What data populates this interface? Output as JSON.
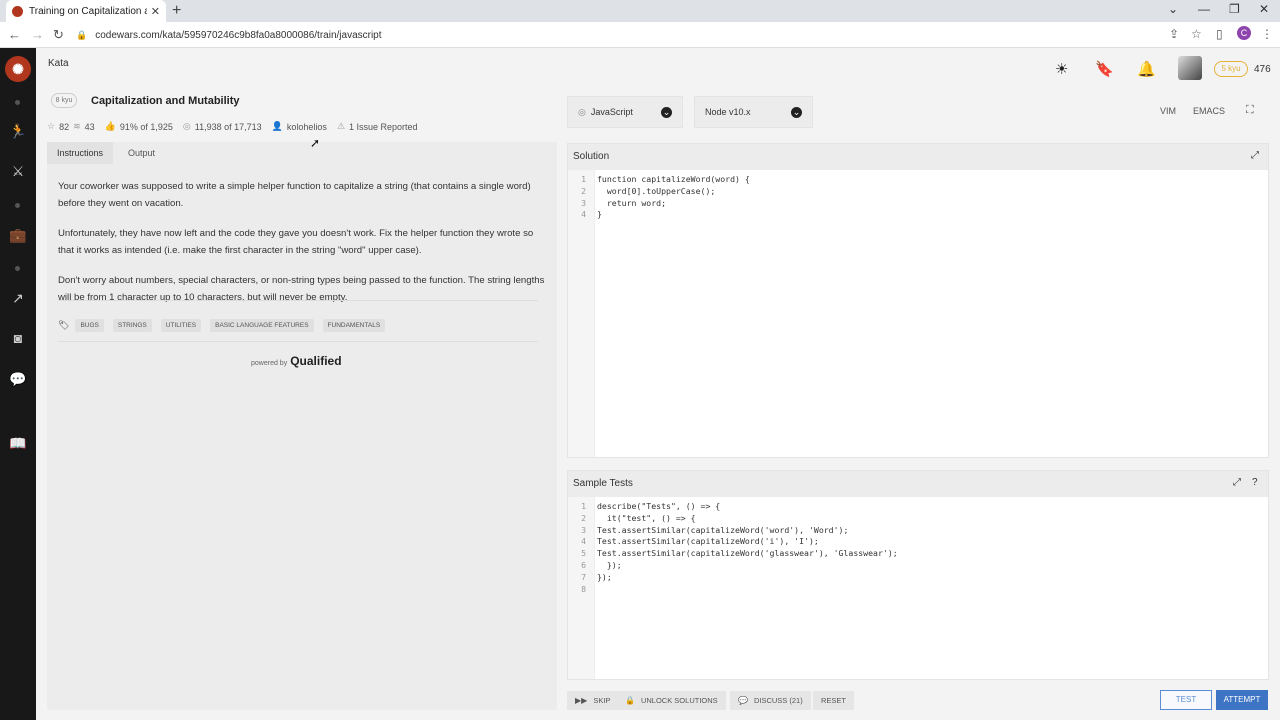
{
  "browser": {
    "tab_title": "Training on Capitalization and M",
    "url": "codewars.com/kata/595970246c9b8fa0a8000086/train/javascript",
    "profile_initial": "C"
  },
  "header": {
    "kata_link": "Kata",
    "rank_badge": "5 kyu",
    "honor": "476"
  },
  "kata": {
    "kyu": "8 kyu",
    "title": "Capitalization and Mutability",
    "stars": "82",
    "collections": "43",
    "satisfaction": "91% of 1,925",
    "completions": "11,938 of 17,713",
    "author": "kolohelios",
    "issues": "1 Issue Reported"
  },
  "left_tabs": [
    "Instructions",
    "Output"
  ],
  "description": [
    "Your coworker was supposed to write a simple helper function to capitalize a string (that contains a single word) before they went on vacation.",
    "Unfortunately, they have now left and the code they gave you doesn't work. Fix the helper function they wrote so that it works as intended (i.e. make the first character in the string \"word\" upper case).",
    "Don't worry about numbers, special characters, or non-string types being passed to the function. The string lengths will be from 1 character up to 10 characters, but will never be empty."
  ],
  "tags": [
    "BUGS",
    "STRINGS",
    "UTILITIES",
    "BASIC LANGUAGE FEATURES",
    "FUNDAMENTALS"
  ],
  "powered": {
    "label": "powered by",
    "brand": "Qualified"
  },
  "language": "JavaScript",
  "runtime": "Node v10.x",
  "modes": {
    "vim": "VIM",
    "emacs": "EMACS"
  },
  "solution": {
    "title": "Solution",
    "lines": [
      "function capitalizeWord(word) {",
      "  word[0].toUpperCase();",
      "  return word;",
      "}"
    ]
  },
  "tests": {
    "title": "Sample Tests",
    "lines": [
      "describe(\"Tests\", () => {",
      "  it(\"test\", () => {",
      "Test.assertSimilar(capitalizeWord('word'), 'Word');",
      "Test.assertSimilar(capitalizeWord('i'), 'I');",
      "Test.assertSimilar(capitalizeWord('glasswear'), 'Glasswear');",
      "  });",
      "});",
      ""
    ]
  },
  "actions": {
    "skip": "SKIP",
    "unlock": "UNLOCK SOLUTIONS",
    "discuss": "DISCUSS (21)",
    "reset": "RESET",
    "test": "TEST",
    "attempt": "ATTEMPT"
  }
}
